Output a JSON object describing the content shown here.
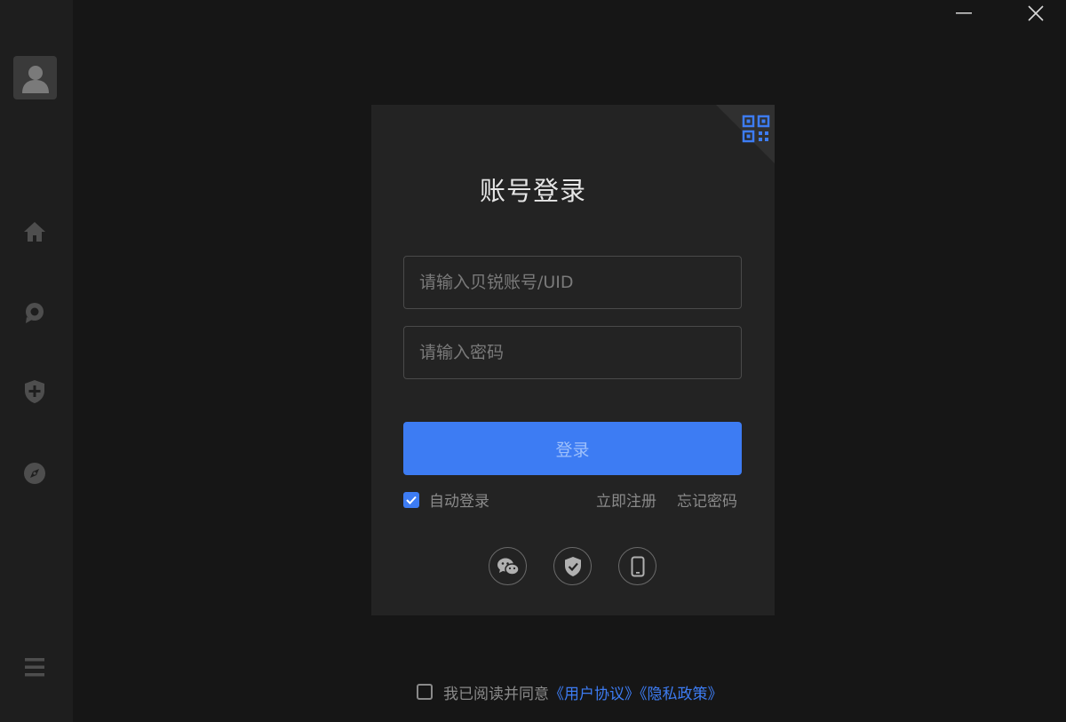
{
  "window": {
    "minimize_icon": "minimize-icon",
    "close_icon": "close-icon"
  },
  "sidebar": {
    "avatar_icon": "user-icon",
    "items": [
      {
        "icon": "home-icon"
      },
      {
        "icon": "chat-icon"
      },
      {
        "icon": "shield-plus-icon"
      },
      {
        "icon": "compass-icon"
      }
    ],
    "menu_icon": "menu-icon"
  },
  "login": {
    "qr_icon": "qr-code-icon",
    "title": "账号登录",
    "account_placeholder": "请输入贝锐账号/UID",
    "password_placeholder": "请输入密码",
    "login_button": "登录",
    "auto_login_label": "自动登录",
    "auto_login_checked": true,
    "register_link": "立即注册",
    "forgot_link": "忘记密码",
    "social": [
      {
        "icon": "wechat-icon"
      },
      {
        "icon": "shield-check-icon"
      },
      {
        "icon": "phone-icon"
      }
    ]
  },
  "agreement": {
    "checked": false,
    "prefix": "我已阅读并同意",
    "user_agreement": "《用户协议》",
    "privacy_policy": "《隐私政策》"
  },
  "colors": {
    "accent": "#3d7cf3",
    "background": "#161616",
    "sidebar": "#1e1e1e",
    "card": "#232323"
  }
}
